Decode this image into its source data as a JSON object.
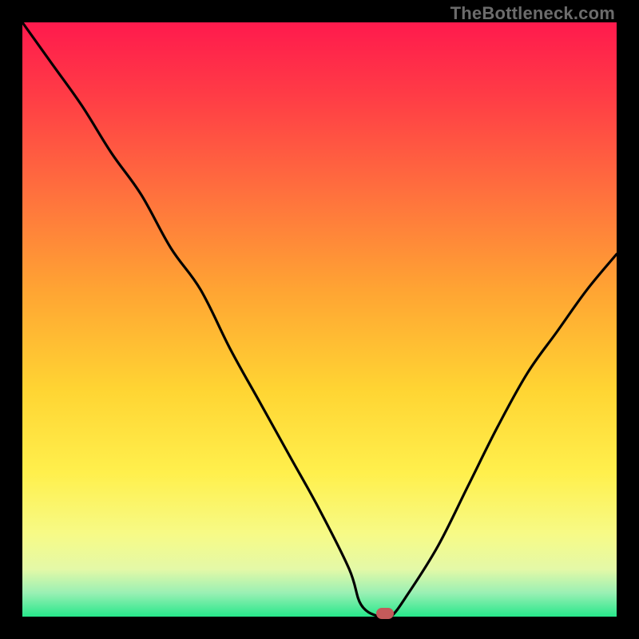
{
  "watermark": "TheBottleneck.com",
  "colors": {
    "frame": "#000000",
    "curve": "#000000",
    "marker": "#c45a5a",
    "gradient_top": "#ff1a4d",
    "gradient_mid": "#ffd533",
    "gradient_bottom": "#27e78b"
  },
  "chart_data": {
    "type": "line",
    "title": "",
    "xlabel": "",
    "ylabel": "",
    "xlim": [
      0,
      100
    ],
    "ylim": [
      0,
      100
    ],
    "grid": false,
    "x": [
      0,
      5,
      10,
      15,
      20,
      25,
      30,
      35,
      40,
      45,
      50,
      55,
      57,
      60,
      62,
      65,
      70,
      75,
      80,
      85,
      90,
      95,
      100
    ],
    "values": [
      100,
      93,
      86,
      78,
      71,
      62,
      55,
      45,
      36,
      27,
      18,
      8,
      2,
      0,
      0,
      4,
      12,
      22,
      32,
      41,
      48,
      55,
      61
    ],
    "minimum_x": 61,
    "minimum_y": 0,
    "note": "V-shaped bottleneck curve; values in percent (0-100), y=0 at bottom (optimal), y=100 at top (worst). Curve derived visually from gradient-backed plot."
  }
}
